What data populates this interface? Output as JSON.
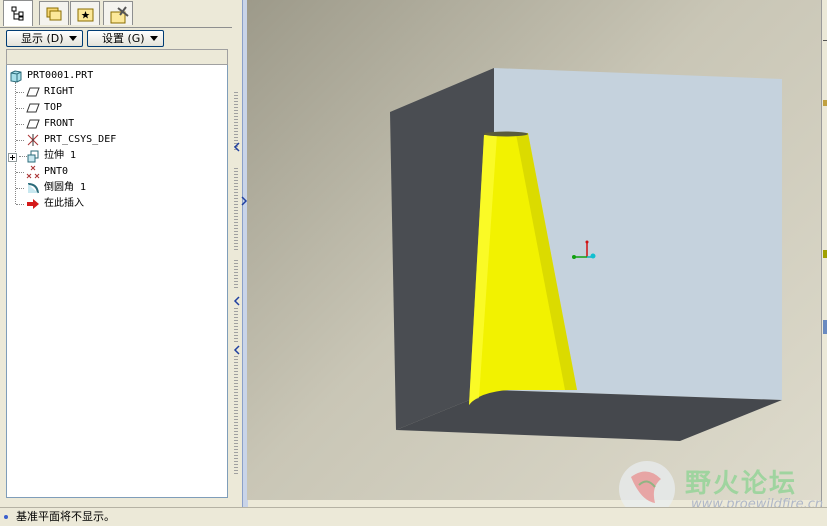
{
  "navigator": {
    "tabs": [
      {
        "name": "model-tree-tab",
        "icon": "tree-icon"
      },
      {
        "name": "folder-browser-tab",
        "icon": "folders-icon"
      },
      {
        "name": "favorites-tab",
        "icon": "star-icon"
      },
      {
        "name": "connections-tab",
        "icon": "tools-icon"
      }
    ],
    "display_button_label": "显示 (D)",
    "settings_button_label": "设置 (G)"
  },
  "model_tree": {
    "root": "PRT0001.PRT",
    "items": [
      {
        "label": "RIGHT",
        "icon": "datum-plane-icon"
      },
      {
        "label": "TOP",
        "icon": "datum-plane-icon"
      },
      {
        "label": "FRONT",
        "icon": "datum-plane-icon"
      },
      {
        "label": "PRT_CSYS_DEF",
        "icon": "coordinate-system-icon"
      },
      {
        "label": "拉伸 1",
        "icon": "extrude-icon"
      },
      {
        "label": "PNT0",
        "icon": "datum-point-icon"
      },
      {
        "label": "倒圆角 1",
        "icon": "round-icon"
      },
      {
        "label": "在此插入",
        "icon": "insert-here-arrow-icon"
      }
    ]
  },
  "status": {
    "message": "基准平面将不显示。"
  },
  "watermark": {
    "text": "野火论坛",
    "url": "www.proewildfire.cn"
  },
  "colors": {
    "cone": "#ffff00",
    "box_face_light": "#c5d2dd",
    "box_face_dark": "#4a4d52",
    "background": "#d0cdbd"
  }
}
